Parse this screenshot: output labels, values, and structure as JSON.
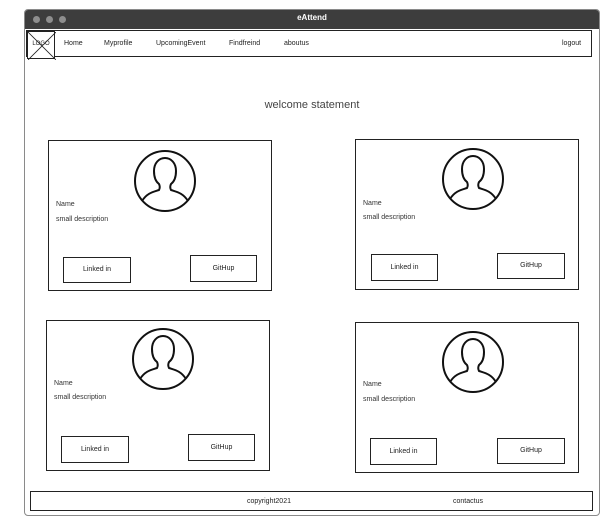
{
  "window": {
    "title": "eAttend"
  },
  "nav": {
    "logo_text": "LOGO",
    "items": [
      {
        "label": "Home"
      },
      {
        "label": "Myprofile"
      },
      {
        "label": "UpcomingEvent"
      },
      {
        "label": "Findfreind"
      },
      {
        "label": "aboutus"
      }
    ],
    "logout": "logout"
  },
  "main": {
    "welcome": "welcome statement"
  },
  "cards": [
    {
      "name": "Name",
      "description": "small description",
      "linkedin": "Linked in",
      "github": "GitHup"
    },
    {
      "name": "Name",
      "description": "small description",
      "linkedin": "Linked in",
      "github": "GitHup"
    },
    {
      "name": "Name",
      "description": "small description",
      "linkedin": "Linked in",
      "github": "GitHup"
    },
    {
      "name": "Name",
      "description": "small description",
      "linkedin": "Linked in",
      "github": "GitHup"
    }
  ],
  "icons": {
    "avatar": "user-avatar-icon",
    "logo": "image-placeholder-icon"
  },
  "footer": {
    "copyright": "copyright2021",
    "contact": "contactus"
  }
}
